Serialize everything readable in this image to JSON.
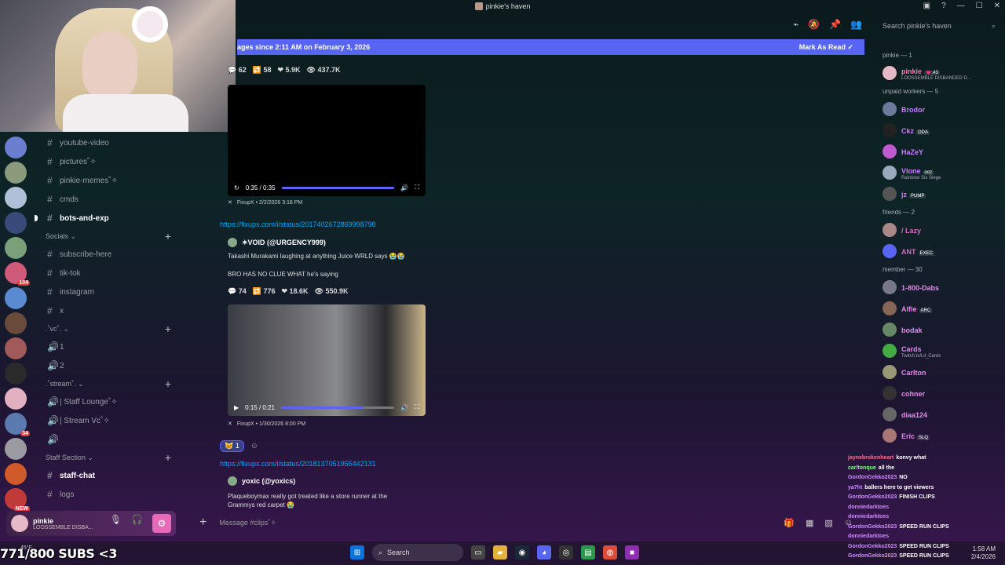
{
  "window": {
    "title": "pinkie's haven"
  },
  "header": {
    "search_placeholder": "Search pinkie's haven"
  },
  "new_messages": {
    "text": "ages since 2:11 AM on February 3, 2026",
    "mark_read": "Mark As Read"
  },
  "channels": {
    "items_top": [
      {
        "name": "youtube-video"
      },
      {
        "name": "pictures˚✧"
      },
      {
        "name": "pinkie-memes˚✧"
      },
      {
        "name": "cmds"
      },
      {
        "name": "bots-and-exp"
      }
    ],
    "socials_label": "Socials",
    "socials": [
      {
        "name": "subscribe-here"
      },
      {
        "name": "tik-tok"
      },
      {
        "name": "instagram"
      },
      {
        "name": "x"
      }
    ],
    "vc_label": ".˚vc˚.",
    "vc": [
      {
        "name": "1"
      },
      {
        "name": "2"
      }
    ],
    "stream_label": ".˚stream˚.",
    "stream": [
      {
        "name": "| Staff Lounge˚✧"
      },
      {
        "name": "| Stream Vc˚✧"
      },
      {
        "name": ""
      }
    ],
    "staff_label": "Staff Section",
    "staff": [
      {
        "name": "staff-chat"
      },
      {
        "name": "logs"
      }
    ]
  },
  "servers": {
    "badges": [
      "",
      "",
      "",
      "",
      "",
      "104",
      "",
      "",
      "",
      "",
      "",
      "34",
      "",
      "",
      "NEW"
    ]
  },
  "user_panel": {
    "name": "pinkie",
    "status": "LOOSSEMBLE DISBA..."
  },
  "composer": {
    "placeholder": "Message #clips˚✧"
  },
  "messages": {
    "stats1": {
      "replies": "62",
      "retweets": "58",
      "likes": "5.9K",
      "views": "437.7K"
    },
    "video1": {
      "time": "0:35 / 0:35",
      "progress": 1.0
    },
    "footer1": "FixupX • 2/2/2026 3:18 PM",
    "link1": "https://fixupx.com/i/status/2017402672869998798",
    "author2": "✶VOID (@URGENCY999)",
    "text2a": "Takashi Murakami laughing at anything Juice WRLD says 😭😭",
    "text2b": "BRO HAS NO CLUE WHAT he's saying",
    "stats2": {
      "replies": "74",
      "retweets": "776",
      "likes": "18.6K",
      "views": "550.9K"
    },
    "video2": {
      "time": "0:15 / 0:21",
      "progress": 0.72
    },
    "footer2": "FixupX • 1/30/2026 8:00 PM",
    "reaction": {
      "emoji": "😿",
      "count": "1"
    },
    "link3": "https://fixupx.com/i/status/2018137051955442131",
    "author3": "yoxic (@yoxics)",
    "text3": "Plaqueboymax really got treated like a store runner at the Grammys red carpet 😭"
  },
  "members": {
    "groups": [
      {
        "label": "pinkie — 1",
        "items": [
          {
            "name": "pinkie",
            "tag": "💗.43",
            "sub": "LOOSSEMBLE DISBANDED D...",
            "color": "#f47fb6",
            "av": "#e6b9c7"
          }
        ]
      },
      {
        "label": "unpaid workers — 5",
        "items": [
          {
            "name": "Brodor",
            "tag": "",
            "sub": "",
            "color": "#c77dff",
            "av": "#6c7a9c"
          },
          {
            "name": "Ckz",
            "tag": "ODA",
            "sub": "",
            "color": "#c77dff",
            "av": "#222"
          },
          {
            "name": "HaZeY",
            "tag": "",
            "sub": "",
            "color": "#c77dff",
            "av": "#c05ad0"
          },
          {
            "name": "Vlone",
            "tag": "ooz",
            "sub": "Rainbow Six Siege",
            "color": "#c77dff",
            "av": "#9ab"
          },
          {
            "name": "jz",
            "tag": "PUMP",
            "sub": "",
            "color": "#c77dff",
            "av": "#555"
          }
        ]
      },
      {
        "label": "friends — 2",
        "items": [
          {
            "name": "/ Lazy",
            "tag": "",
            "sub": "",
            "color": "#d46ac0",
            "av": "#a88"
          },
          {
            "name": "ANT",
            "tag": "EXEC",
            "sub": "",
            "color": "#d46ac0",
            "av": "#5865f2"
          }
        ]
      },
      {
        "label": "member — 30",
        "items": [
          {
            "name": "1-800-Dabs",
            "tag": "",
            "sub": "",
            "color": "#e08ae8",
            "av": "#778"
          },
          {
            "name": "Alfie",
            "tag": "ARC",
            "sub": "",
            "color": "#e08ae8",
            "av": "#865"
          },
          {
            "name": "bodak",
            "tag": "",
            "sub": "",
            "color": "#e08ae8",
            "av": "#686"
          },
          {
            "name": "Cards",
            "tag": "",
            "sub": "Twitch.tv/Lil_Cards",
            "color": "#e08ae8",
            "av": "#4a4"
          },
          {
            "name": "Carlton",
            "tag": "",
            "sub": "",
            "color": "#e08ae8",
            "av": "#997"
          },
          {
            "name": "cohner",
            "tag": "",
            "sub": "",
            "color": "#e08ae8",
            "av": "#333"
          },
          {
            "name": "diaa124",
            "tag": "",
            "sub": "",
            "color": "#e08ae8",
            "av": "#666"
          },
          {
            "name": "Eric",
            "tag": "SLQ",
            "sub": "",
            "color": "#e08ae8",
            "av": "#a77"
          }
        ]
      }
    ]
  },
  "stream_chat": [
    {
      "user": "jaynebrokenheart",
      "msg": "konvy what",
      "color": "#ff6b8b"
    },
    {
      "user": "carltonque",
      "msg": "all the",
      "color": "#7fff7f"
    },
    {
      "user": "GordonGekko2023",
      "msg": "NO",
      "color": "#d08aff"
    },
    {
      "user": "ya7ht",
      "msg": "ballers here to get viewers",
      "color": "#d08aff"
    },
    {
      "user": "GordonGekko2023",
      "msg": "FINISH CLIPS",
      "color": "#d08aff"
    },
    {
      "user": "donniedarktoes",
      "msg": "",
      "color": "#d08aff"
    },
    {
      "user": "donniedarktoes",
      "msg": "",
      "color": "#d08aff"
    },
    {
      "user": "GordonGekko2023",
      "msg": "SPEED RUN CLIPS",
      "color": "#d08aff"
    },
    {
      "user": "donniedarktoes",
      "msg": "",
      "color": "#d08aff"
    },
    {
      "user": "GordonGekko2023",
      "msg": "SPEED RUN CLIPS",
      "color": "#d08aff"
    },
    {
      "user": "GordonGekko2023",
      "msg": "SPEED RUN CLIPS",
      "color": "#d08aff"
    }
  ],
  "subs_goal": "771/800 SUBS <3",
  "taskbar": {
    "search": "Search",
    "time": "1:58 AM",
    "date": "2/4/2026",
    "temp": "45°F"
  }
}
